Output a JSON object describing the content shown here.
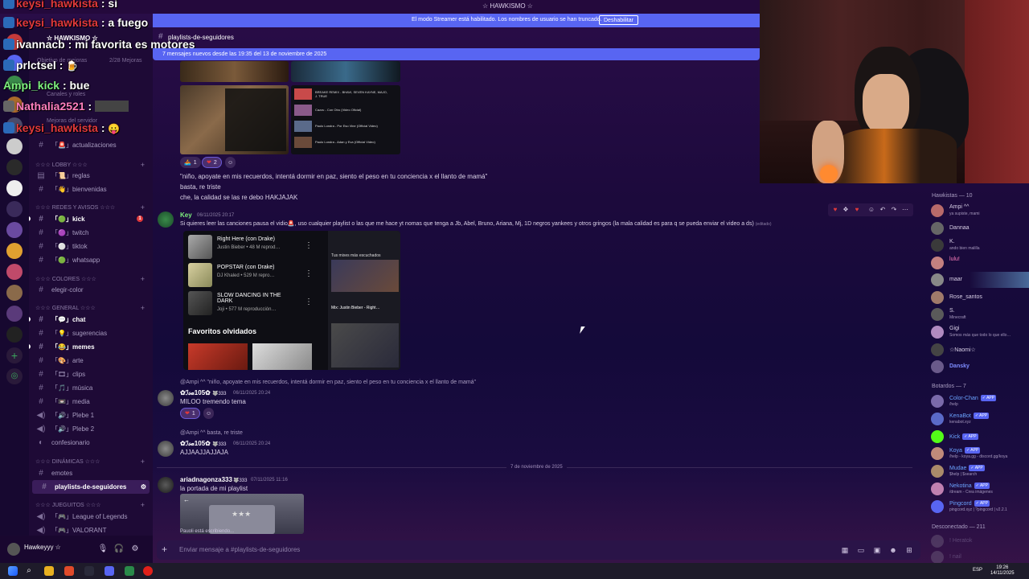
{
  "window": {
    "title": "☆ HAWKISMO ☆"
  },
  "banner": {
    "message": "El modo Streamer está habilitado. Los nombres de usuario se han truncado.",
    "button": "Deshabilitar"
  },
  "overlay_chat": [
    {
      "user": "keysi_hawkista",
      "text": ": si",
      "color": "#e0393b"
    },
    {
      "user": "keysi_hawkista",
      "text": ": a fuego",
      "color": "#e0393b"
    },
    {
      "user": "ivannacb",
      "text": ": mi favorita es motores",
      "color": "#ffffff"
    },
    {
      "user": "prlctsel",
      "text": ":",
      "color": "#ffffff"
    },
    {
      "user": "Ampi_kick",
      "text": ": bue",
      "color": "#7ef07e"
    },
    {
      "user": "Nathalia2521",
      "text": ":",
      "color": "#ff7fbf"
    },
    {
      "user": "keysi_hawkista",
      "text": ":",
      "color": "#e0393b"
    }
  ],
  "sidebar": {
    "server_name": "☆ HAWKISMO ☆",
    "boost_line": "Objetivo de mejoras",
    "boost_count": "2/28 Mejoras",
    "faded_items": [
      "Canales y roles",
      "Mejoras del servidor"
    ],
    "channels": [
      {
        "label": "「🚨」actualizaciones",
        "bold": false
      },
      {
        "category": "☆☆☆ LOBBY ☆☆☆"
      },
      {
        "label": "「📜」reglas",
        "bold": false
      },
      {
        "label": "「👋」bienvenidas",
        "bold": false
      },
      {
        "category": "☆☆☆ REDES Y AVISOS ☆☆☆"
      },
      {
        "label": "「🟢」kick",
        "bold": true,
        "ping": "1"
      },
      {
        "label": "「🟣」twitch",
        "bold": false
      },
      {
        "label": "「⚪」tiktok",
        "bold": false
      },
      {
        "label": "「🟢」whatsapp",
        "bold": false
      },
      {
        "category": "☆☆☆ COLORES ☆☆☆"
      },
      {
        "label": "elegir-color",
        "bold": false
      },
      {
        "category": "☆☆☆ GENERAL ☆☆☆"
      },
      {
        "label": "「💬」chat",
        "bold": true
      },
      {
        "label": "「💡」sugerencias",
        "bold": false
      },
      {
        "label": "「😂」memes",
        "bold": true
      },
      {
        "label": "「🎨」arte",
        "bold": false
      },
      {
        "label": "「🎞」clips",
        "bold": false
      },
      {
        "label": "「🎵」música",
        "bold": false
      },
      {
        "label": "「📼」media",
        "bold": false
      },
      {
        "label": "「🔊」Plebe 1",
        "bold": false
      },
      {
        "label": "「🔊」Plebe 2",
        "bold": false
      },
      {
        "label": "confesionario",
        "bold": false
      },
      {
        "category": "☆☆☆ DINÁMICAS ☆☆☆"
      },
      {
        "label": "emotes",
        "bold": false
      },
      {
        "label": "playlists-de-seguidores",
        "bold": true,
        "active": true
      },
      {
        "category": "☆☆☆ JUEGUITOS ☆☆☆"
      },
      {
        "label": "「🎮」League of Legends",
        "bold": false
      },
      {
        "label": "「🎮」VALORANT",
        "bold": false
      }
    ]
  },
  "user_panel": {
    "name": "Hawkeyyy ☆"
  },
  "channel": {
    "name": "playlists-de-seguidores",
    "new_messages": "7 mensajes nuevos desde las 19:35 del 13 de noviembre de 2025"
  },
  "messages": {
    "m1": {
      "reactions": [
        {
          "emoji": "🚣",
          "count": "1"
        },
        {
          "emoji": "❤",
          "count": "2"
        }
      ],
      "lines": [
        "\"niño, apoyate en mis recuerdos, intentá dormir en paz, siento el peso en tu conciencia x el llanto de mamá\"",
        "basta, re triste",
        "che, la calidad se las re debo HAKJAJAK"
      ],
      "preview_titles": [
        "BREAKE REMIX - BHAVI, SEVEN KAYNE, MAJO, J. TRUE",
        "Cazzu - Con Otro (Video Oficial)",
        "Paulo Londra - Por Eso Vine (Official Video)",
        "Paulo Londra - Adan y Eva (Official Video)"
      ]
    },
    "m2": {
      "author": "Key",
      "time": "06/11/2025 20:17",
      "text": "Si quieres leer las canciones pausa el vidio🚨, uso cualquier playlist o las que me hace yt nomas que tenga a Jb, Abel, Bruno, Ariana, Mj, 1D  negros yankees y otros gringos (la mala calidad es para q se pueda enviar el video a ds)",
      "edited": "(editado)",
      "yt": [
        {
          "title": "Right Here (con Drake)",
          "sub": "Justin Bieber • 48 M reprod…"
        },
        {
          "title": "POPSTAR (con Drake)",
          "sub": "DJ Khaled • 529 M repro…"
        },
        {
          "title": "SLOW DANCING IN THE DARK",
          "sub": "Joji • 577 M reproducción…"
        }
      ],
      "favoritos": "Favoritos olvidados",
      "mix_label": "Tus mixes más escuchados",
      "mix_title": "Mix: Justin Bieber - Right…"
    },
    "m3": {
      "reply": "@Ampi ^^ \"niño, apoyate en mis recuerdos, intentá dormir en paz, siento el peso en tu conciencia x el llanto de mamá\"",
      "author": "✿ℐ𝓈𝒶105✿",
      "badge": "🐺333",
      "time": "06/11/2025 20:24",
      "text": "MILOO tremendo tema",
      "reaction": {
        "emoji": "❤",
        "count": "1"
      }
    },
    "m4": {
      "reply": "@Ampi ^^ basta, re triste",
      "author": "✿ℐ𝓈𝒶105✿",
      "badge": "🐺333",
      "time": "06/11/2025 20:24",
      "text": "AJJAAJJAJJAJA"
    },
    "date_divider": "7 de noviembre de 2025",
    "m5": {
      "author": "ariadnagonza333",
      "badge": "🐺333",
      "time": "07/11/2025 11:16",
      "text": "la portada de mi playlist",
      "image_stars": "★★★"
    }
  },
  "typing": "Pauoli está escribiendo...",
  "composer": {
    "placeholder": "Enviar mensaje a #playlists-de-seguidores"
  },
  "members": {
    "online_header": "Hawkistas — 10",
    "online": [
      {
        "name": "Ampi ^^",
        "status": "ya supiste, mami",
        "color": "#d8cfe6",
        "avatar": "#b86a6a"
      },
      {
        "name": "Dannaa",
        "status": "",
        "color": "#d8cfe6",
        "avatar": "#666"
      },
      {
        "name": "K.",
        "status": "ando bien malilla",
        "color": "#d8cfe6",
        "avatar": "#3a3a3a"
      },
      {
        "name": "lulu!",
        "status": "",
        "color": "#ff7fbf",
        "avatar": "#c48080"
      },
      {
        "name": "maar",
        "status": "",
        "color": "#d8cfe6",
        "avatar": "#888"
      },
      {
        "name": "Rose_santos",
        "status": "",
        "color": "#d8cfe6",
        "avatar": "#a07a6a"
      },
      {
        "name": "S.",
        "status": "Minecraft",
        "color": "#d8cfe6",
        "avatar": "#5a5a5a"
      },
      {
        "name": "Gigi",
        "status": "Somos más que todo lo que ello…",
        "color": "#d8cfe6",
        "avatar": "#b08ac0"
      },
      {
        "name": "☆Naomi☆",
        "status": "",
        "color": "#d8cfe6",
        "avatar": "#444"
      },
      {
        "name": "Dansky",
        "status": "",
        "color": "#7d8cff",
        "avatar": "#6a5a8a"
      }
    ],
    "bots_header": "Botardos — 7",
    "bots": [
      {
        "name": "Color-Chan",
        "status": "/help",
        "color": "#6aa3ff",
        "avatar": "#7a6aaa"
      },
      {
        "name": "KenaBot",
        "status": "kenabot.xyz",
        "color": "#6aa3ff",
        "avatar": "#5a6ac8"
      },
      {
        "name": "Kick",
        "status": "",
        "color": "#6aa3ff",
        "avatar": "#53fc18"
      },
      {
        "name": "Koya",
        "status": "/help - koya.gg - discord.gg/koya",
        "color": "#6aa3ff",
        "avatar": "#c08a7a"
      },
      {
        "name": "Mudae",
        "status": "$help | $search",
        "color": "#6aa3ff",
        "avatar": "#aa8a6a"
      },
      {
        "name": "Nekotina",
        "status": "/dream - Crea imágenes",
        "color": "#6aa3ff",
        "avatar": "#c080b0"
      },
      {
        "name": "Pingcord",
        "status": "pingcord.xyz | ?pingcord | v2.2.1",
        "color": "#6aa3ff",
        "avatar": "#5865f2"
      }
    ],
    "offline_header": "Desconectado — 211",
    "offline": [
      {
        "name": "! Heratok",
        "color": "#8a7aa4"
      },
      {
        "name": "! nail",
        "color": "#8a7aa4"
      }
    ]
  },
  "taskbar": {
    "time": "19:26",
    "date": "14/11/2025",
    "lang": "ESP"
  }
}
